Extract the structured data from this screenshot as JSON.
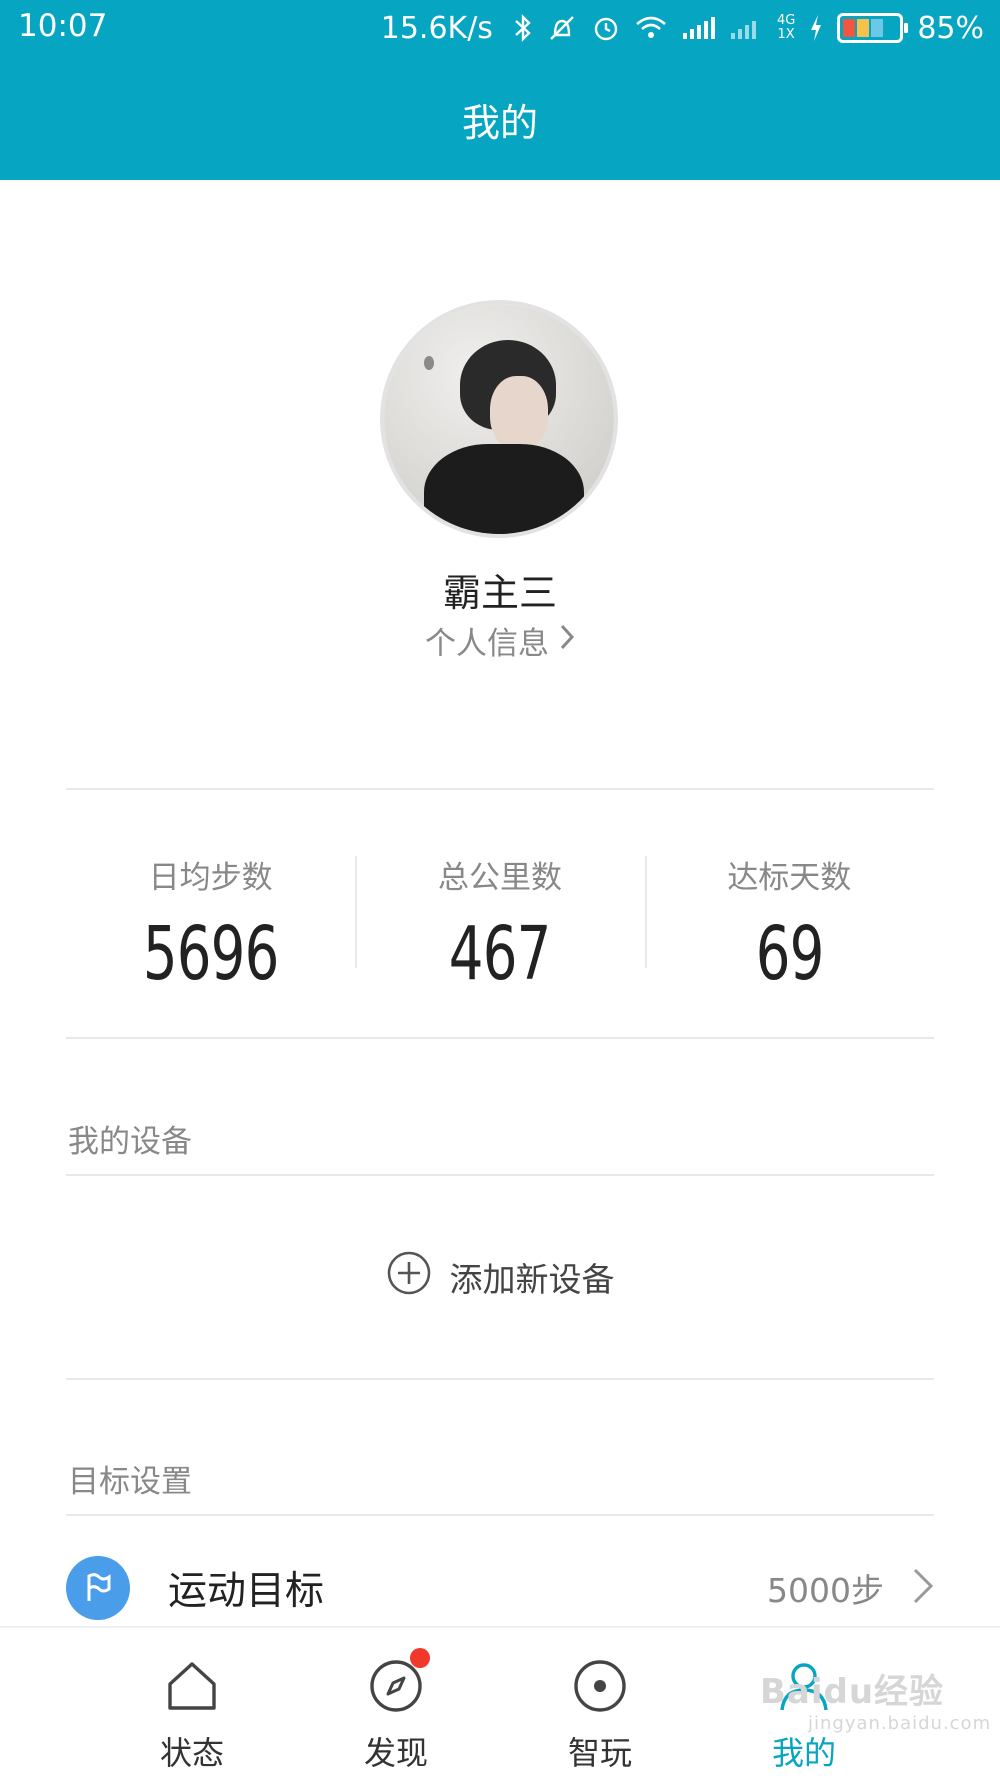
{
  "status_bar": {
    "time": "10:07",
    "net_speed": "15.6K/s",
    "lte_top": "4G",
    "lte_bottom": "1X",
    "battery": "85%"
  },
  "header": {
    "title": "我的"
  },
  "profile": {
    "username": "霸主三",
    "info_link": "个人信息"
  },
  "stats": [
    {
      "label": "日均步数",
      "value": "5696"
    },
    {
      "label": "总公里数",
      "value": "467"
    },
    {
      "label": "达标天数",
      "value": "69"
    }
  ],
  "devices": {
    "section_title": "我的设备",
    "add_label": "添加新设备"
  },
  "goals": {
    "section_title": "目标设置",
    "items": [
      {
        "label": "运动目标",
        "value": "5000步"
      }
    ]
  },
  "tabbar": {
    "items": [
      {
        "label": "状态",
        "icon": "home-icon"
      },
      {
        "label": "发现",
        "icon": "compass-icon"
      },
      {
        "label": "智玩",
        "icon": "target-icon"
      },
      {
        "label": "我的",
        "icon": "person-icon"
      }
    ],
    "active_color": "#06a5c2"
  },
  "watermark": {
    "brand": "Baidu经验",
    "url": "jingyan.baidu.com"
  },
  "colors": {
    "header": "#06a5c2",
    "goal_icon": "#4a9de9",
    "badge": "#f2372b"
  }
}
